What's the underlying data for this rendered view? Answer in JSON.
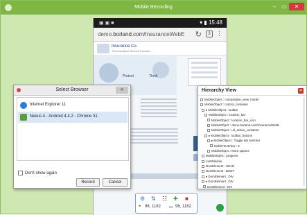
{
  "window": {
    "title": "Mobile Recording",
    "minimize": "–",
    "maximize": "▭",
    "close": "✕"
  },
  "phone": {
    "status": {
      "icons": "▣ ▣ ■",
      "right": "▾ ▮ 15:48"
    },
    "url_prefix": "demo.",
    "url_host": "borland.com",
    "url_path": "/InsuranceWebE",
    "site": {
      "name": "Insurance Co.",
      "tagline": "The Insurance Service Provider",
      "protect": "Protect",
      "think": "Think"
    }
  },
  "toolbar": {
    "coords_left": "96, 1182",
    "coords_right": "96, 1182"
  },
  "dialog": {
    "title": "Select Browser",
    "close": "✕",
    "browsers": [
      {
        "label": "Internet Explorer 11"
      },
      {
        "label": "Nexus 4 - Android 4.4.2 - Chrome 31"
      }
    ],
    "dont_show": "Don't show again",
    "record_btn": "Record",
    "cancel_btn": "Cancel"
  },
  "hierarchy": {
    "title": "Hierarchy View",
    "close": "✕",
    "rows": [
      "MobileObject : composition_view_holder",
      "MobileObject : control_container",
      "▸ MobileObject : toolbar",
      "MobileObject : location_bar",
      "MobileObject : location_bar_icon",
      "MobileObject : demo.borland.com/InsuranceWebE",
      "MobileObject : url_action_container",
      "▸ MobileObject : toolbar_buttons",
      "▸ MobileObject : Toggle tab switcher",
      "MobileTextView : 3",
      "MobileObject : More options",
      "MobileObject : progress",
      "rootWindow",
      "DomElement : HEAD",
      "DomElement : BODY",
      "▸ DomElement : DIV",
      "▸ DomElement : DIV",
      "DomElement : DIV"
    ]
  },
  "colors": {
    "titlebar": "#80b743",
    "frame_bg": "#cfe7b0",
    "close_red": "#d9363e",
    "toolbar_border": "#6fa8dc",
    "record_dot": "#2ea043"
  }
}
